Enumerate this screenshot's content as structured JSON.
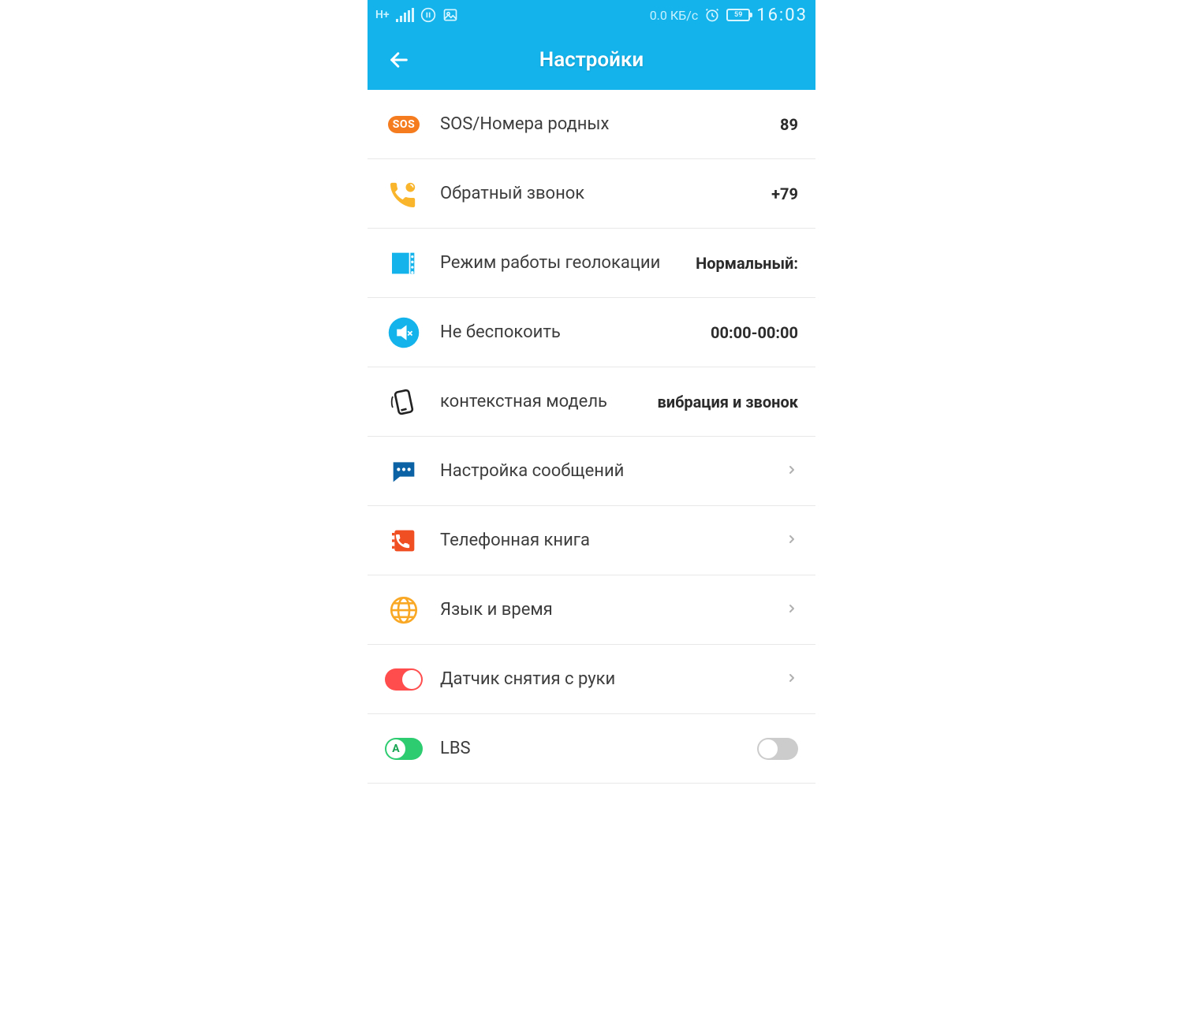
{
  "status": {
    "network_indicator": "H+",
    "data_rate": "0.0 КБ/с",
    "battery": "59",
    "time": "16:03"
  },
  "header": {
    "title": "Настройки"
  },
  "items": {
    "sos": {
      "label": "SOS/Номера родных",
      "value": "89"
    },
    "callback": {
      "label": "Обратный звонок",
      "value": "+79"
    },
    "geo": {
      "label": "Режим работы геолокации",
      "value": "Нормальный:"
    },
    "dnd": {
      "label": "Не беспокоить",
      "value": "00:00-00:00"
    },
    "profile": {
      "label": "контекстная модель",
      "value": "вибрация и звонок"
    },
    "messages": {
      "label": "Настройка сообщений"
    },
    "phonebook": {
      "label": "Телефонная книга"
    },
    "langtime": {
      "label": "Язык и время"
    },
    "takeoff": {
      "label": "Датчик снятия с руки"
    },
    "lbs": {
      "label": "LBS"
    }
  },
  "icons": {
    "sos_text": "SOS"
  }
}
